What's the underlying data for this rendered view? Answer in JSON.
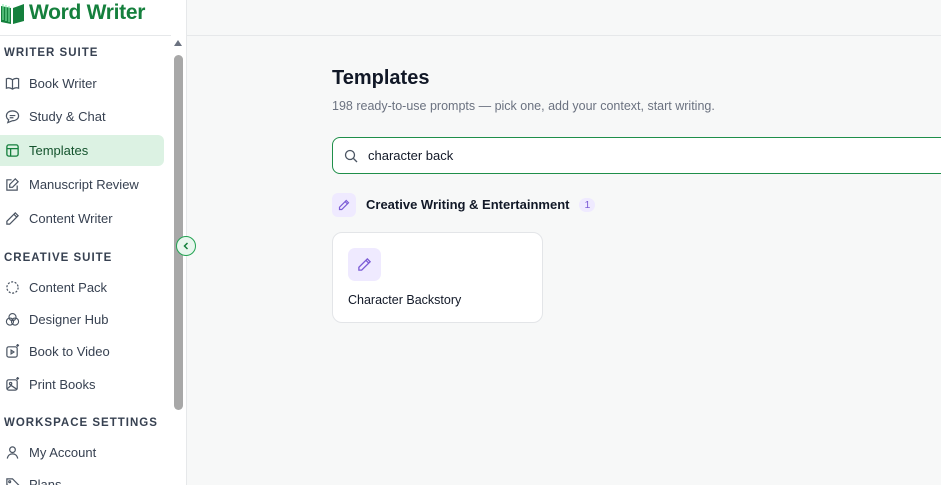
{
  "app": {
    "name": "Word Writer",
    "accent": "#15803d"
  },
  "sidebar": {
    "sections": [
      {
        "heading": "WRITER SUITE",
        "items": [
          {
            "label": "Book Writer",
            "icon": "book-open-icon"
          },
          {
            "label": "Study & Chat",
            "icon": "chat-bubble-icon"
          },
          {
            "label": "Templates",
            "icon": "template-icon",
            "active": true
          },
          {
            "label": "Manuscript Review",
            "icon": "edit-document-icon"
          },
          {
            "label": "Content Writer",
            "icon": "pencil-icon"
          }
        ]
      },
      {
        "heading": "CREATIVE SUITE",
        "items": [
          {
            "label": "Content Pack",
            "icon": "loader-circle-icon"
          },
          {
            "label": "Designer Hub",
            "icon": "color-circles-icon"
          },
          {
            "label": "Book to Video",
            "icon": "video-icon"
          },
          {
            "label": "Print Books",
            "icon": "image-icon"
          }
        ]
      },
      {
        "heading": "WORKSPACE SETTINGS",
        "items": [
          {
            "label": "My Account",
            "icon": "user-icon"
          },
          {
            "label": "Plans",
            "icon": "tag-icon"
          }
        ]
      }
    ]
  },
  "main": {
    "title": "Templates",
    "subtitle": "198 ready-to-use prompts — pick one, add your context, start writing.",
    "search": {
      "value": "character back",
      "icon": "search-icon"
    },
    "category": {
      "name": "Creative Writing & Entertainment",
      "count": "1",
      "icon": "pencil-icon",
      "color": "#7c5cd6"
    },
    "cards": [
      {
        "title": "Character Backstory",
        "icon": "pencil-icon"
      }
    ]
  }
}
